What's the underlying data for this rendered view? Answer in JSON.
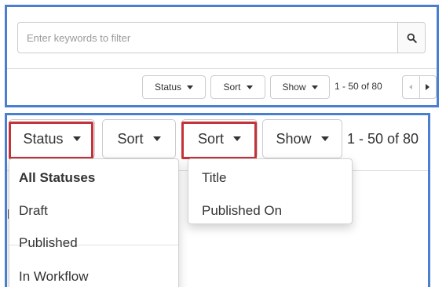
{
  "search": {
    "placeholder": "Enter keywords to filter"
  },
  "toolbar": {
    "status_label": "Status",
    "sort_label": "Sort",
    "show_label": "Show",
    "range_text": "1 - 50 of 80"
  },
  "zoomed": {
    "status_label": "Status",
    "sort_label": "Sort",
    "sort_open_label": "Sort",
    "show_label": "Show",
    "range_text": "1 - 50 of 80"
  },
  "status_menu": {
    "items": [
      {
        "label": "All Statuses",
        "active": true
      },
      {
        "label": "Draft"
      },
      {
        "label": "Published"
      },
      {
        "label": "In Workflow"
      }
    ]
  },
  "sort_menu": {
    "items": [
      {
        "label": "Title"
      },
      {
        "label": "Published On"
      }
    ]
  },
  "icons": {
    "search": "search-icon",
    "caret": "caret-down-icon",
    "prev": "chevron-left-icon",
    "next": "chevron-right-icon"
  },
  "colors": {
    "panel_border": "#4a7fd0",
    "highlight": "#c4323a"
  },
  "peek_char": "b"
}
